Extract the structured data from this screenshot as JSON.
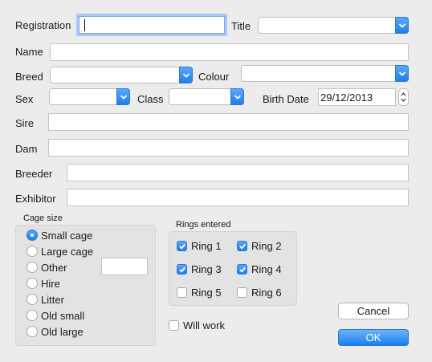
{
  "labels": {
    "registration": "Registration",
    "title": "Title",
    "name": "Name",
    "breed": "Breed",
    "colour": "Colour",
    "sex": "Sex",
    "class": "Class",
    "birth_date": "Birth Date",
    "sire": "Sire",
    "dam": "Dam",
    "breeder": "Breeder",
    "exhibitor": "Exhibitor"
  },
  "fields": {
    "registration": "",
    "title": "",
    "name": "",
    "breed": "",
    "colour": "",
    "sex": "",
    "class": "",
    "birth_date": "29/12/2013",
    "sire": "",
    "dam": "",
    "breeder": "",
    "exhibitor": "",
    "other_size": ""
  },
  "cage_size": {
    "title": "Cage size",
    "options": [
      {
        "label": "Small cage",
        "selected": true
      },
      {
        "label": "Large cage",
        "selected": false
      },
      {
        "label": "Other",
        "selected": false
      },
      {
        "label": "Hire",
        "selected": false
      },
      {
        "label": "Litter",
        "selected": false
      },
      {
        "label": "Old small",
        "selected": false
      },
      {
        "label": "Old large",
        "selected": false
      }
    ]
  },
  "rings": {
    "title": "Rings entered",
    "items": [
      {
        "label": "Ring 1",
        "checked": true
      },
      {
        "label": "Ring 2",
        "checked": true
      },
      {
        "label": "Ring 3",
        "checked": true
      },
      {
        "label": "Ring 4",
        "checked": true
      },
      {
        "label": "Ring 5",
        "checked": false
      },
      {
        "label": "Ring 6",
        "checked": false
      }
    ]
  },
  "will_work": {
    "label": "Will work",
    "checked": false
  },
  "buttons": {
    "cancel": "Cancel",
    "ok": "OK"
  },
  "colors": {
    "accent": "#1f7fe8",
    "background": "#ececec"
  }
}
